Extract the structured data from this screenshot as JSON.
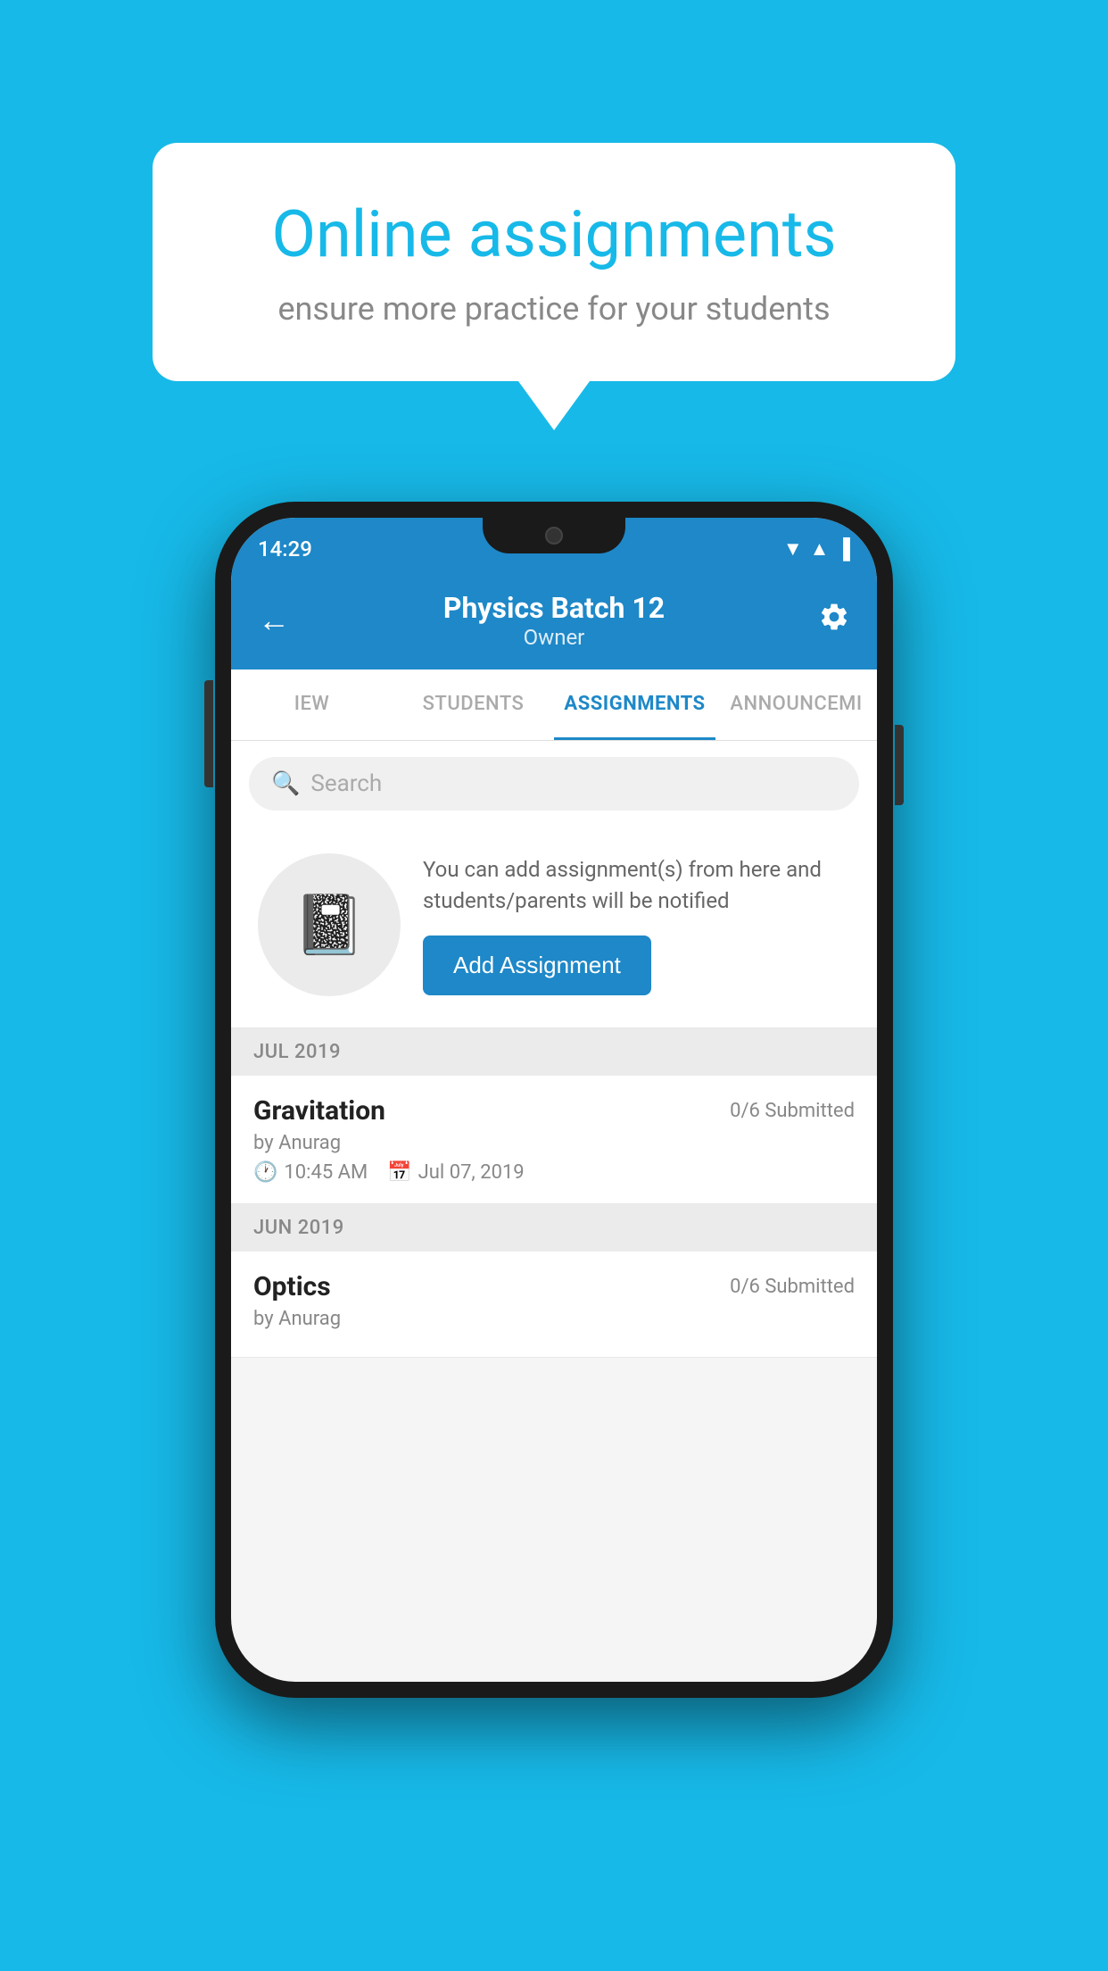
{
  "background_color": "#17B9E8",
  "speech_bubble": {
    "title": "Online assignments",
    "subtitle": "ensure more practice for your students"
  },
  "status_bar": {
    "time": "14:29",
    "wifi_icon": "▼",
    "signal_icon": "▲",
    "battery_icon": "▐"
  },
  "app_bar": {
    "title": "Physics Batch 12",
    "subtitle": "Owner",
    "back_label": "←",
    "settings_label": "⚙"
  },
  "tabs": [
    {
      "label": "IEW",
      "active": false
    },
    {
      "label": "STUDENTS",
      "active": false
    },
    {
      "label": "ASSIGNMENTS",
      "active": true
    },
    {
      "label": "ANNOUNCEMI",
      "active": false
    }
  ],
  "search": {
    "placeholder": "Search"
  },
  "add_assignment_card": {
    "description": "You can add assignment(s) from here and students/parents will be notified",
    "button_label": "Add Assignment"
  },
  "sections": [
    {
      "header": "JUL 2019",
      "items": [
        {
          "name": "Gravitation",
          "submitted": "0/6 Submitted",
          "author": "by Anurag",
          "time": "10:45 AM",
          "date": "Jul 07, 2019"
        }
      ]
    },
    {
      "header": "JUN 2019",
      "items": [
        {
          "name": "Optics",
          "submitted": "0/6 Submitted",
          "author": "by Anurag",
          "time": "",
          "date": ""
        }
      ]
    }
  ]
}
